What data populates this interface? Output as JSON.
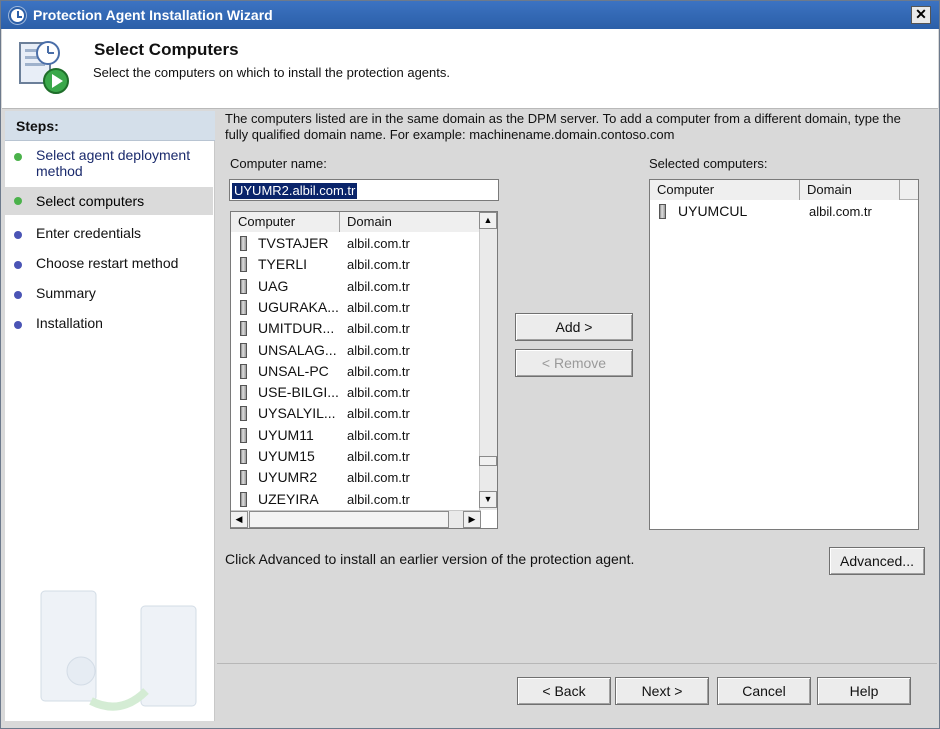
{
  "window": {
    "title": "Protection Agent Installation Wizard",
    "close_label": "✕"
  },
  "header": {
    "title": "Select Computers",
    "subtitle": "Select the computers on which to install the protection agents."
  },
  "sidebar": {
    "heading": "Steps:",
    "items": [
      {
        "label": "Select agent deployment method",
        "status": "done"
      },
      {
        "label": "Select computers",
        "status": "current"
      },
      {
        "label": "Enter credentials",
        "status": "pending"
      },
      {
        "label": "Choose restart method",
        "status": "pending"
      },
      {
        "label": "Summary",
        "status": "pending"
      },
      {
        "label": "Installation",
        "status": "pending"
      }
    ]
  },
  "main": {
    "description": "The computers listed are in the same domain as the DPM server. To add a computer from a different domain, type the fully qualified domain name. For example: machinename.domain.contoso.com",
    "computer_name_label": "Computer name:",
    "computer_name_value": "UYUMR2.albil.com.tr",
    "available": {
      "columns": [
        "Computer",
        "Domain"
      ],
      "rows": [
        {
          "computer": "TVSTAJER",
          "domain": "albil.com.tr"
        },
        {
          "computer": "TYERLI",
          "domain": "albil.com.tr"
        },
        {
          "computer": "UAG",
          "domain": "albil.com.tr"
        },
        {
          "computer": "UGURAKA...",
          "domain": "albil.com.tr"
        },
        {
          "computer": "UMITDUR...",
          "domain": "albil.com.tr"
        },
        {
          "computer": "UNSALAG...",
          "domain": "albil.com.tr"
        },
        {
          "computer": "UNSAL-PC",
          "domain": "albil.com.tr"
        },
        {
          "computer": "USE-BILGI...",
          "domain": "albil.com.tr"
        },
        {
          "computer": "UYSALYIL...",
          "domain": "albil.com.tr"
        },
        {
          "computer": "UYUM11",
          "domain": "albil.com.tr"
        },
        {
          "computer": "UYUM15",
          "domain": "albil.com.tr"
        },
        {
          "computer": "UYUMR2",
          "domain": "albil.com.tr"
        },
        {
          "computer": "UZEYIRA",
          "domain": "albil.com.tr"
        }
      ]
    },
    "add_button": "Add >",
    "remove_button": "< Remove",
    "selected_label": "Selected computers:",
    "selected": {
      "columns": [
        "Computer",
        "Domain"
      ],
      "rows": [
        {
          "computer": "UYUMCUL",
          "domain": "albil.com.tr"
        }
      ]
    },
    "advanced_note": "Click Advanced to install an earlier version of the protection agent.",
    "advanced_button": "Advanced..."
  },
  "footer": {
    "back": "< Back",
    "next": "Next >",
    "cancel": "Cancel",
    "help": "Help"
  }
}
